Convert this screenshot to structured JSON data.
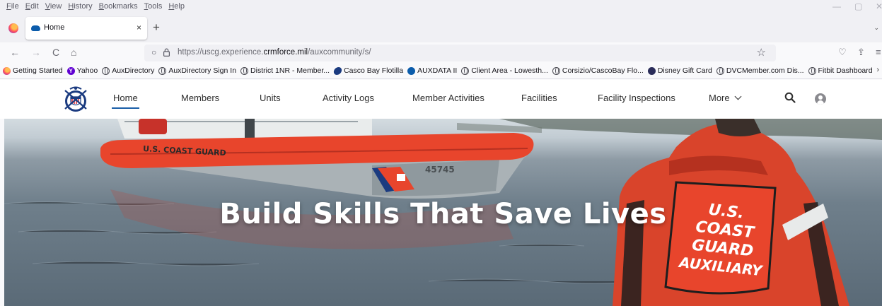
{
  "browser": {
    "menu": [
      "File",
      "Edit",
      "View",
      "History",
      "Bookmarks",
      "Tools",
      "Help"
    ],
    "tab": {
      "title": "Home",
      "close": "×",
      "new_tab": "+"
    },
    "nav": {
      "back": "←",
      "forward": "→",
      "reload": "C",
      "home": "⌂"
    },
    "url": {
      "prefix": "https://uscg.experience.",
      "domain": "crmforce.mil",
      "path": "/auxcommunity/s/"
    },
    "bookmarks": [
      {
        "label": "Getting Started",
        "icon": "firefox-icon"
      },
      {
        "label": "Yahoo",
        "icon": "yahoo-icon"
      },
      {
        "label": "AuxDirectory",
        "icon": "globe-icon"
      },
      {
        "label": "AuxDirectory Sign In",
        "icon": "globe-icon"
      },
      {
        "label": "District 1NR - Member...",
        "icon": "globe-icon"
      },
      {
        "label": "Casco Bay Flotilla",
        "icon": "casco-icon"
      },
      {
        "label": "AUXDATA II",
        "icon": "cloud-icon"
      },
      {
        "label": "Client Area - Lowesth...",
        "icon": "globe-icon"
      },
      {
        "label": "Corsizio/CascoBay Flo...",
        "icon": "globe-icon"
      },
      {
        "label": "Disney Gift Card",
        "icon": "disney-icon"
      },
      {
        "label": "DVCMember.com Dis...",
        "icon": "globe-icon"
      },
      {
        "label": "Fitbit Dashboard",
        "icon": "globe-icon"
      }
    ]
  },
  "site": {
    "nav": {
      "home": "Home",
      "members": "Members",
      "units": "Units",
      "activity_logs": "Activity Logs",
      "member_activities": "Member Activities",
      "facilities": "Facilities",
      "facility_inspections": "Facility Inspections",
      "more": "More"
    },
    "hero": {
      "title": "Build Skills That Save Lives",
      "boat_text": "U.S. COAST GUARD",
      "boat_number": "45745",
      "vest_text": [
        "U.S.",
        "COAST",
        "GUARD",
        "AUXILIARY"
      ]
    }
  },
  "colors": {
    "accent": "#1b5fa8",
    "coast_guard_orange": "#e8452c",
    "header_bg": "#ffffff"
  }
}
